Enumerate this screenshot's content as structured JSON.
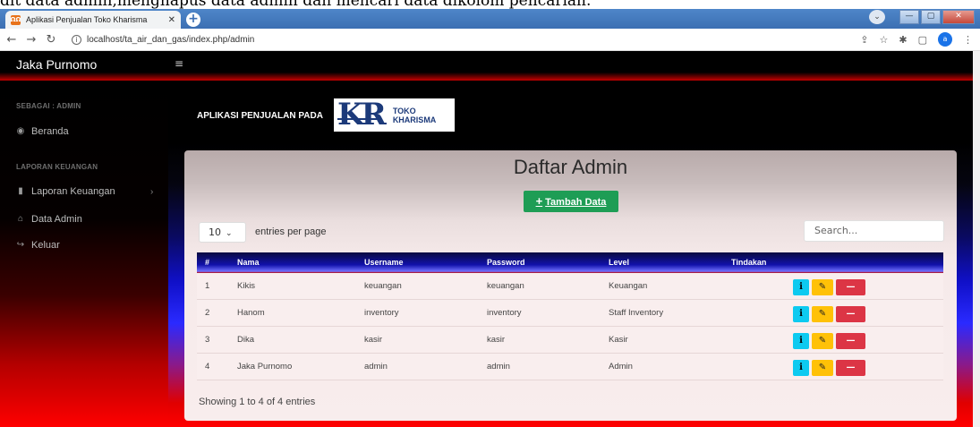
{
  "caption": "dit data admin,menghapus data admin dan mencari data dikolom pencarian.",
  "browser": {
    "tab_title": "Aplikasi Penjualan Toko Kharisma",
    "tab_close": "✕",
    "favicon_text": "ΩΩ",
    "new_tab": "+",
    "url": "localhost/ta_air_dan_gas/index.php/admin",
    "win_min": "—",
    "win_max": "▢",
    "win_close": "✕",
    "profile_letter": "a"
  },
  "navbar": {
    "brand": "Jaka Purnomo",
    "menu_icon": "≡"
  },
  "sidebar": {
    "heading_role": "SEBAGAI : ADMIN",
    "heading_finance": "LAPORAN KEUANGAN",
    "items": [
      {
        "label": "Beranda",
        "icon": "dashboard-icon"
      },
      {
        "label": "Laporan Keuangan",
        "icon": "book-icon"
      },
      {
        "label": "Data Admin",
        "icon": "bank-icon"
      },
      {
        "label": "Keluar",
        "icon": "logout-icon"
      }
    ]
  },
  "header": {
    "app_title": "APLIKASI PENJUALAN PADA",
    "logo_letters": "KR",
    "logo_line1": "TOKO",
    "logo_line2": "KHARISMA"
  },
  "card": {
    "title": "Daftar Admin",
    "add_button": "Tambah Data",
    "entries_value": "10",
    "entries_label": "entries per page",
    "search_placeholder": "Search...",
    "footer": "Showing 1 to 4 of 4 entries"
  },
  "table": {
    "columns": [
      "#",
      "Nama",
      "Username",
      "Password",
      "Level",
      "Tindakan"
    ],
    "rows": [
      {
        "no": "1",
        "nama": "Kikis",
        "username": "keuangan",
        "password": "keuangan",
        "level": "Keuangan"
      },
      {
        "no": "2",
        "nama": "Hanom",
        "username": "inventory",
        "password": "inventory",
        "level": "Staff Inventory"
      },
      {
        "no": "3",
        "nama": "Dika",
        "username": "kasir",
        "password": "kasir",
        "level": "Kasir"
      },
      {
        "no": "4",
        "nama": "Jaka Purnomo",
        "username": "admin",
        "password": "admin",
        "level": "Admin"
      }
    ],
    "action_info": "i",
    "action_edit": "✎",
    "action_delete": "—"
  },
  "colors": {
    "navbar": "#000000",
    "accent_red": "#ff0000",
    "accent_blue": "#2a2aff",
    "add_button": "#1e9d55",
    "info_button": "#0dcaf0",
    "edit_button": "#ffc107",
    "delete_button": "#dc3545"
  }
}
